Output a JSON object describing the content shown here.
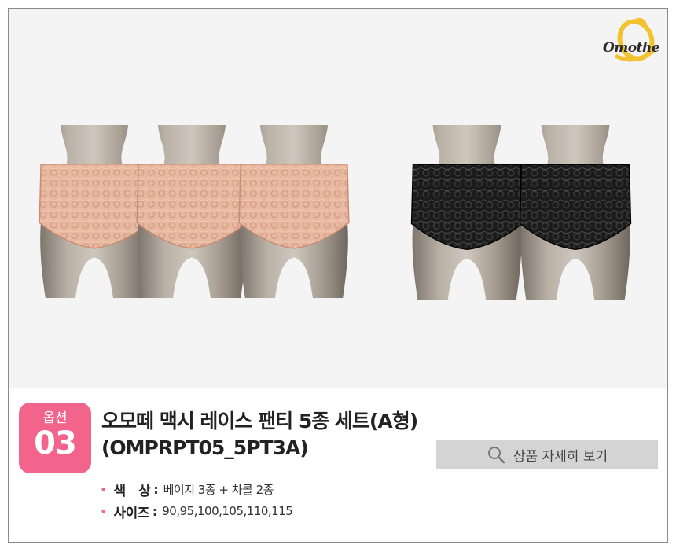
{
  "brand": {
    "logo_text": "Omothe"
  },
  "option": {
    "label": "옵션",
    "number": "03"
  },
  "product": {
    "title_line1": "오모떼 맥시 레이스 팬티 5종 세트(A형)",
    "title_line2": "(OMPRPT05_5PT3A)"
  },
  "detail_button": {
    "label": "상품 자세히 보기",
    "icon": "search-icon"
  },
  "specs": [
    {
      "label": "색　상",
      "value": "베이지 3종 + 차콜 2종"
    },
    {
      "label": "사이즈",
      "value": "90,95,100,105,110,115"
    }
  ],
  "colors": {
    "accent_pink": "#f2648c",
    "beige_lace": "#e6b49c",
    "charcoal_lace": "#1c1c1c",
    "mannequin": "#a39a90",
    "button_bg": "#d4d4d4"
  },
  "products": [
    {
      "color": "beige"
    },
    {
      "color": "beige"
    },
    {
      "color": "beige"
    },
    {
      "color": "charcoal"
    },
    {
      "color": "charcoal"
    }
  ]
}
